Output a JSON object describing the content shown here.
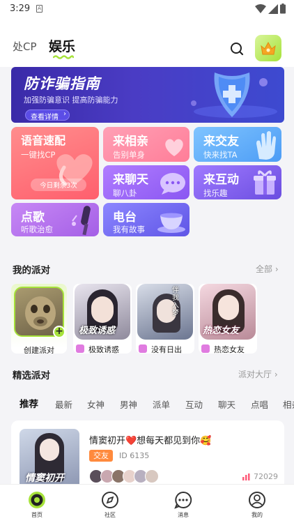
{
  "status": {
    "time": "3:29"
  },
  "header": {
    "tab_inactive": "处CP",
    "tab_active": "娱乐"
  },
  "banner": {
    "title": "防诈骗指南",
    "subtitle": "加强防骗意识 提高防骗能力",
    "button": "查看详情"
  },
  "tiles": [
    {
      "title": "语音速配",
      "sub": "一键找CP",
      "badge": "今日剩余3次"
    },
    {
      "title": "来相亲",
      "sub": "告别单身"
    },
    {
      "title": "来交友",
      "sub": "快来找TA"
    },
    {
      "title": "来聊天",
      "sub": "聊八卦"
    },
    {
      "title": "来互动",
      "sub": "找乐趣"
    },
    {
      "title": "点歌",
      "sub": "听歌治愈"
    },
    {
      "title": "电台",
      "sub": "我有故事"
    }
  ],
  "my_party": {
    "title": "我的派对",
    "more": "全部",
    "items": [
      {
        "name": "创建派对",
        "art": ""
      },
      {
        "name": "极致诱惑",
        "art": "极致诱惑"
      },
      {
        "name": "没有日出",
        "art": "伴我入梦"
      },
      {
        "name": "热恋女友",
        "art": "热恋女友"
      }
    ]
  },
  "featured": {
    "title": "精选派对",
    "more": "派对大厅",
    "categories": [
      "推荐",
      "最新",
      "女神",
      "男神",
      "派单",
      "互动",
      "聊天",
      "点唱",
      "相亲"
    ]
  },
  "room_card": {
    "title": "情窦初开❤️想每天都见到你🥰",
    "tag": "交友",
    "id": "ID 6135",
    "count": "72029",
    "cover_text": "情窦初开"
  },
  "nav": [
    {
      "label": "首页"
    },
    {
      "label": "社区"
    },
    {
      "label": "消息"
    },
    {
      "label": "我的"
    }
  ],
  "colors": {
    "accent": "#a6e23a",
    "badge_orange": "#ff8a3d",
    "banner": "#3a2aa8"
  }
}
